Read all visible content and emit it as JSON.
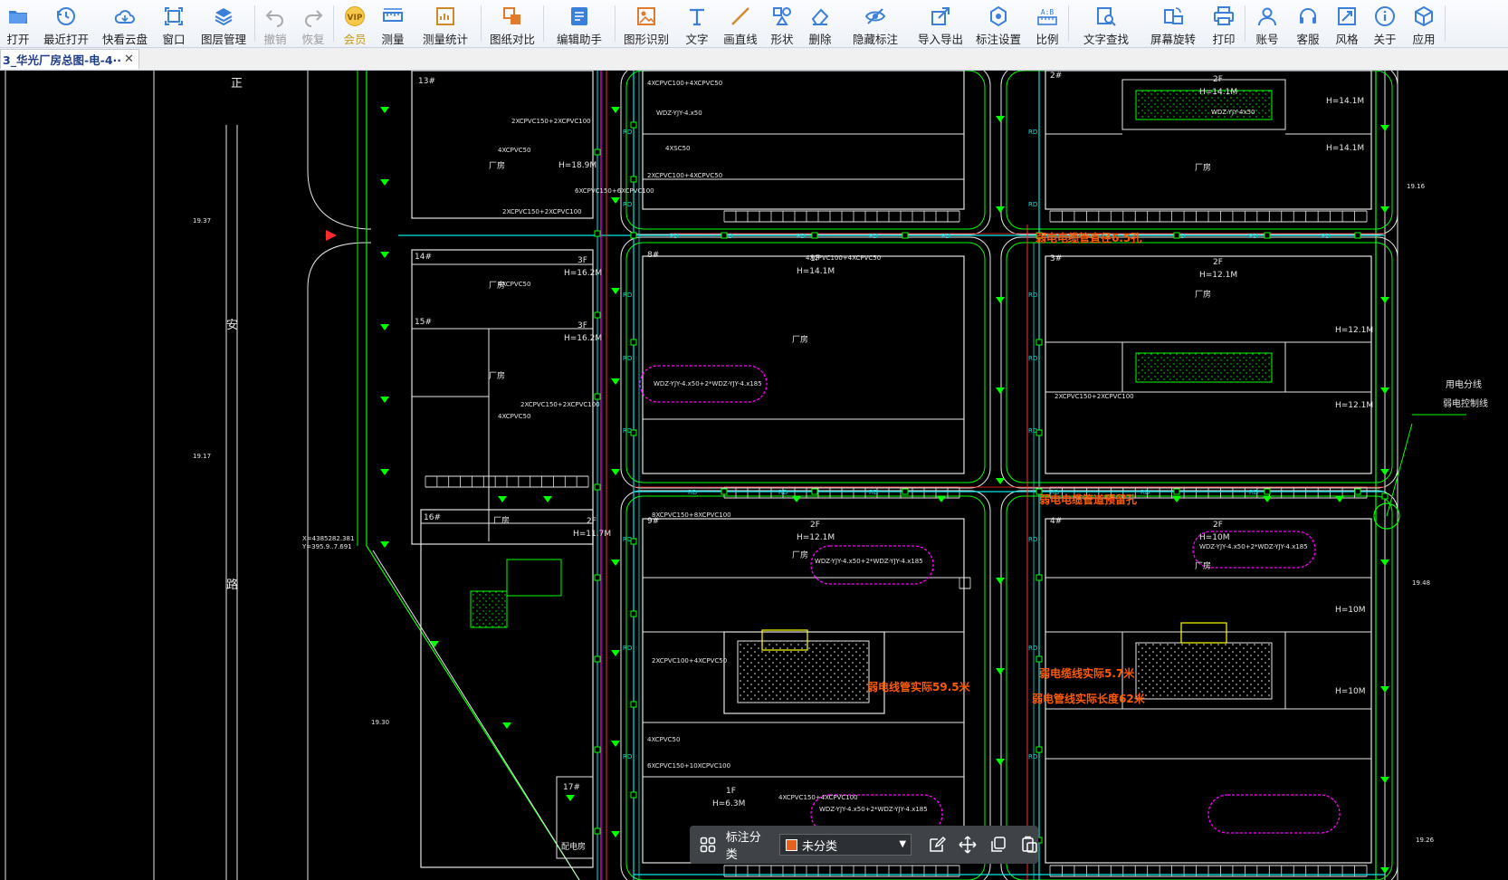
{
  "toolbar": {
    "buttons": [
      {
        "label": "打开",
        "icon": "folder-icon"
      },
      {
        "label": "最近打开",
        "icon": "clock-icon"
      },
      {
        "label": "快看云盘",
        "icon": "cloud-icon"
      },
      {
        "label": "窗口",
        "icon": "window-icon"
      },
      {
        "label": "图层管理",
        "icon": "layers-icon"
      },
      {
        "label": "撤销",
        "icon": "undo-icon"
      },
      {
        "label": "恢复",
        "icon": "redo-icon"
      },
      {
        "label": "会员",
        "icon": "vip-icon"
      },
      {
        "label": "测量",
        "icon": "ruler-icon"
      },
      {
        "label": "测量统计",
        "icon": "measure-stats-icon"
      },
      {
        "label": "图纸对比",
        "icon": "compare-icon"
      },
      {
        "label": "编辑助手",
        "icon": "edit-assistant-icon"
      },
      {
        "label": "图形识别",
        "icon": "shape-recognition-icon"
      },
      {
        "label": "文字",
        "icon": "text-icon"
      },
      {
        "label": "画直线",
        "icon": "line-icon"
      },
      {
        "label": "形状",
        "icon": "shapes-icon"
      },
      {
        "label": "删除",
        "icon": "eraser-icon"
      },
      {
        "label": "隐藏标注",
        "icon": "eye-hide-icon"
      },
      {
        "label": "导入导出",
        "icon": "import-export-icon"
      },
      {
        "label": "标注设置",
        "icon": "annotation-settings-icon"
      },
      {
        "label": "比例",
        "icon": "scale-icon"
      },
      {
        "label": "文字查找",
        "icon": "text-search-icon"
      },
      {
        "label": "屏幕旋转",
        "icon": "rotate-screen-icon"
      },
      {
        "label": "打印",
        "icon": "printer-icon"
      },
      {
        "label": "账号",
        "icon": "user-icon"
      },
      {
        "label": "客服",
        "icon": "headset-icon"
      },
      {
        "label": "风格",
        "icon": "style-icon"
      },
      {
        "label": "关于",
        "icon": "info-icon"
      },
      {
        "label": "应用",
        "icon": "cube-icon"
      }
    ]
  },
  "tab": {
    "title": "3_华光厂房总图-电-4··",
    "close": "✕"
  },
  "colors": {
    "accent": "#2e73d6",
    "cad_green": "#00ff00",
    "cad_white": "#e6e6e6",
    "cad_red": "#ff2a2a",
    "cad_cyan": "#00e5e5",
    "cad_magenta": "#ff00ff",
    "cad_orange": "#ff5a00",
    "cad_yellow": "#ffff00"
  },
  "drawing": {
    "road_labels": [
      "正",
      "安",
      "路"
    ],
    "left_levels": [
      "19.37",
      "19.17",
      "19.30"
    ],
    "right_levels": [
      "19.16",
      "19.48",
      "19.26"
    ],
    "coordinate_note": [
      "X=4385282.381",
      "Y=395.9..7.691"
    ],
    "legend": [
      "用电分线",
      "弱电控制线"
    ],
    "buildings": [
      {
        "name": "13#",
        "type": "厂房"
      },
      {
        "name": "14#",
        "type": "厂房",
        "floors": "3F",
        "height": "H=16.2M"
      },
      {
        "name": "15#",
        "type": "厂房",
        "floors": "3F",
        "height": "H=16.2M"
      },
      {
        "name": "16#",
        "type": "厂房",
        "floors": "2F",
        "height": "H=11.7M"
      },
      {
        "name": "17#",
        "type": "配电房",
        "floors": "1F",
        "height": "H=6.3M"
      },
      {
        "name": "8#",
        "type": "厂房",
        "floors": "1F",
        "height": "H=14.1M"
      },
      {
        "name": "9#",
        "type": "厂房",
        "floors": "2F",
        "height": "H=12.1M"
      },
      {
        "name": "2#",
        "type": "厂房",
        "floors": "2F",
        "height": "H=14.1M"
      },
      {
        "name": "3#",
        "type": "厂房",
        "floors": "2F",
        "height": "H=12.1M"
      },
      {
        "name": "4#",
        "type": "厂房",
        "floors": "2F",
        "height": "H=10M"
      }
    ],
    "height_labels": [
      "H=14.1M",
      "H=12.1M",
      "H=10M",
      "H=18.9M",
      "H=14.1M",
      "H=12.1M",
      "H=10M"
    ],
    "cable_labels": [
      "4XCPVC100+4XCPVC50",
      "2XCPVC150+2XCPVC100",
      "4XCPVC50",
      "4XSC50",
      "2XCPVC100+4XCPVC50",
      "4XCPVC100+4XCPVC50",
      "6XCPVC150+6XCPVC100",
      "2XCPVC150+2XCPVC100",
      "4XCPVC50",
      "2XCPVC150+2XCPVC100",
      "4XCPVC50",
      "8XCPVC150+8XCPVC100",
      "6XCPVC150+10XCPVC100",
      "4XCPVC50",
      "2XCPVC100+4XCPVC50",
      "WDZ-YJY-4x50",
      "2XCPVC150+2XCPVC100",
      "4XCPVC150+4XCPVC100"
    ],
    "wire_labels": [
      "WDZ-YJY-4.x50",
      "WDZ-YJY-4.x50+2*WDZ-YJY-4.x185",
      "WDZ-YJY-4.x50+2*WDZ-YJY-4.x185",
      "WDZ-YJY-4.x50+2*WDZ-YJY-4.x185",
      "WDZ-YJY-4.x50+2*WDZ-YJY-4.x185"
    ],
    "orange_notes": [
      "弱电电缆管直径6.5孔",
      "弱电电缆管道预留孔",
      "弱电线管实际59.5米",
      "弱电缆线实际5.7米",
      "弱电管线实际长度62米"
    ],
    "marker_labels": [
      "RD",
      "PD"
    ]
  },
  "annotation_bar": {
    "label": "标注分类",
    "selected": "未分类"
  }
}
